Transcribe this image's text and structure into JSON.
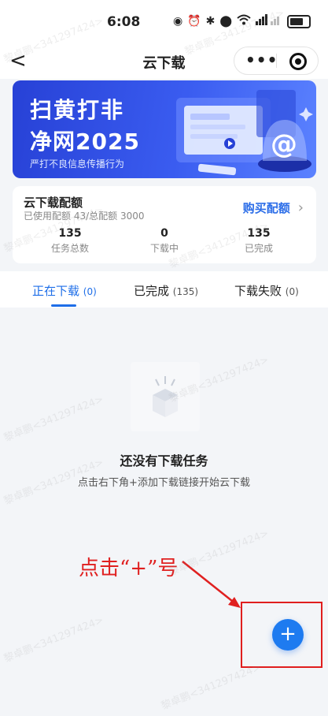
{
  "status_bar": {
    "time": "6:08"
  },
  "nav": {
    "title": "云下载",
    "back": "<",
    "more": "•••"
  },
  "banner": {
    "line1": "扫黄打非",
    "line2": "净网2025",
    "subtitle": "严打不良信息传播行为"
  },
  "quota": {
    "title": "云下载配额",
    "used_text": "已使用配额 43/总配额 3000",
    "buy_label": "购买配额",
    "stats": [
      {
        "value": "135",
        "label": "任务总数"
      },
      {
        "value": "0",
        "label": "下载中"
      },
      {
        "value": "135",
        "label": "已完成"
      }
    ]
  },
  "tabs": [
    {
      "label": "正在下载",
      "count": "(0)",
      "active": true
    },
    {
      "label": "已完成",
      "count": "(135)",
      "active": false
    },
    {
      "label": "下载失败",
      "count": "(0)",
      "active": false
    }
  ],
  "empty": {
    "title": "还没有下载任务",
    "description": "点击右下角+添加下载链接开始云下载"
  },
  "annotation": {
    "text": "点击“+”号"
  },
  "fab": {
    "label": "+"
  },
  "watermark": "黎卓鹏<341297424>",
  "colors": {
    "accent": "#1e6ee8",
    "annotation": "#e02020",
    "banner": "#3a5cf0"
  }
}
